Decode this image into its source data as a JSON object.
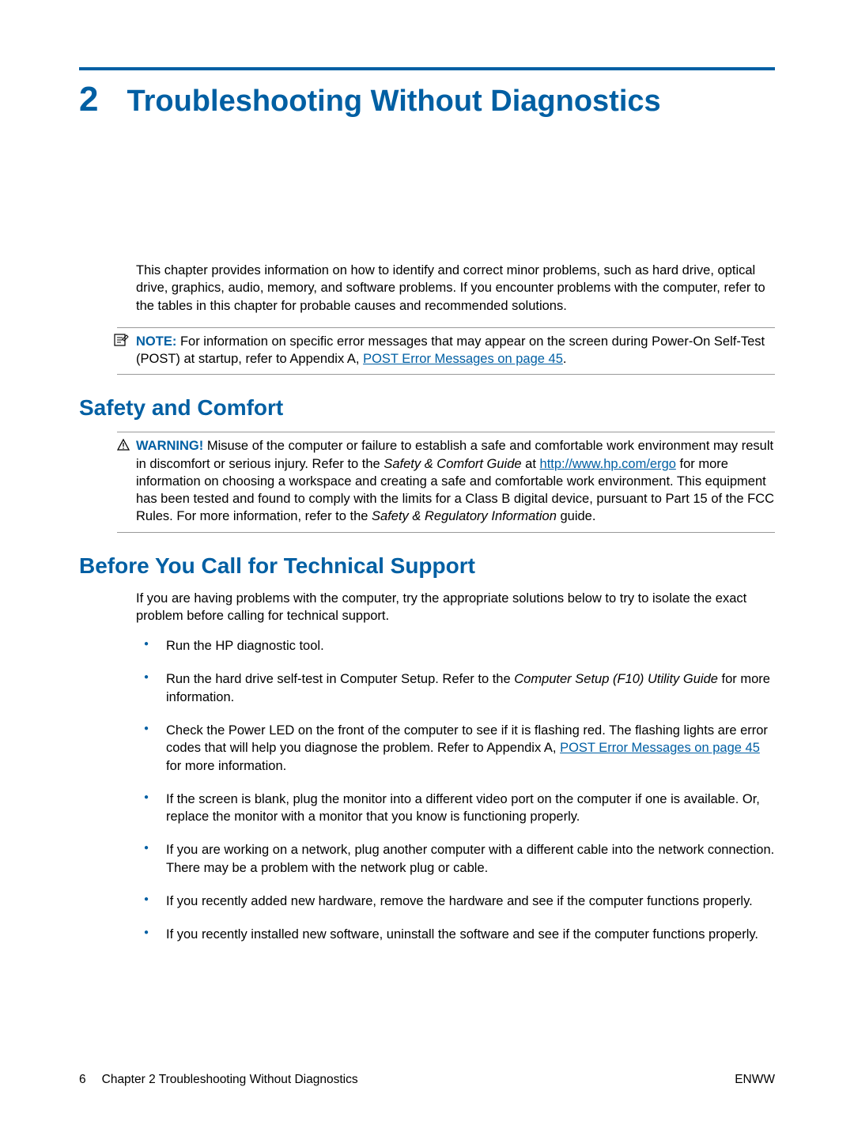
{
  "chapter": {
    "number": "2",
    "title": "Troubleshooting Without Diagnostics"
  },
  "intro": "This chapter provides information on how to identify and correct minor problems, such as hard drive, optical drive, graphics, audio, memory, and software problems. If you encounter problems with the computer, refer to the tables in this chapter for probable causes and recommended solutions.",
  "note": {
    "label": "NOTE:",
    "text_before": "For information on specific error messages that may appear on the screen during Power-On Self-Test (POST) at startup, refer to Appendix A, ",
    "link": "POST Error Messages on page 45",
    "text_after": "."
  },
  "section1": {
    "heading": "Safety and Comfort",
    "warning": {
      "label": "WARNING!",
      "text1": "Misuse of the computer or failure to establish a safe and comfortable work environment may result in discomfort or serious injury. Refer to the ",
      "italic1": "Safety & Comfort Guide",
      "text2": " at ",
      "link": "http://www.hp.com/ergo",
      "text3": " for more information on choosing a workspace and creating a safe and comfortable work environment. This equipment has been tested and found to comply with the limits for a Class B digital device, pursuant to Part 15 of the FCC Rules. For more information, refer to the ",
      "italic2": "Safety & Regulatory Information",
      "text4": " guide."
    }
  },
  "section2": {
    "heading": "Before You Call for Technical Support",
    "intro": "If you are having problems with the computer, try the appropriate solutions below to try to isolate the exact problem before calling for technical support.",
    "items": [
      {
        "text": "Run the HP diagnostic tool."
      },
      {
        "prefix": "Run the hard drive self-test in Computer Setup. Refer to the ",
        "italic": "Computer Setup (F10) Utility Guide",
        "suffix": " for more information."
      },
      {
        "prefix": "Check the Power LED on the front of the computer to see if it is flashing red. The flashing lights are error codes that will help you diagnose the problem. Refer to Appendix A, ",
        "link": "POST Error Messages on page 45",
        "suffix": " for more information."
      },
      {
        "text": "If the screen is blank, plug the monitor into a different video port on the computer if one is available. Or, replace the monitor with a monitor that you know is functioning properly."
      },
      {
        "text": "If you are working on a network, plug another computer with a different cable into the network connection. There may be a problem with the network plug or cable."
      },
      {
        "text": "If you recently added new hardware, remove the hardware and see if the computer functions properly."
      },
      {
        "text": "If you recently installed new software, uninstall the software and see if the computer functions properly."
      }
    ]
  },
  "footer": {
    "page_number": "6",
    "chapter_ref": "Chapter 2   Troubleshooting Without Diagnostics",
    "right": "ENWW"
  }
}
